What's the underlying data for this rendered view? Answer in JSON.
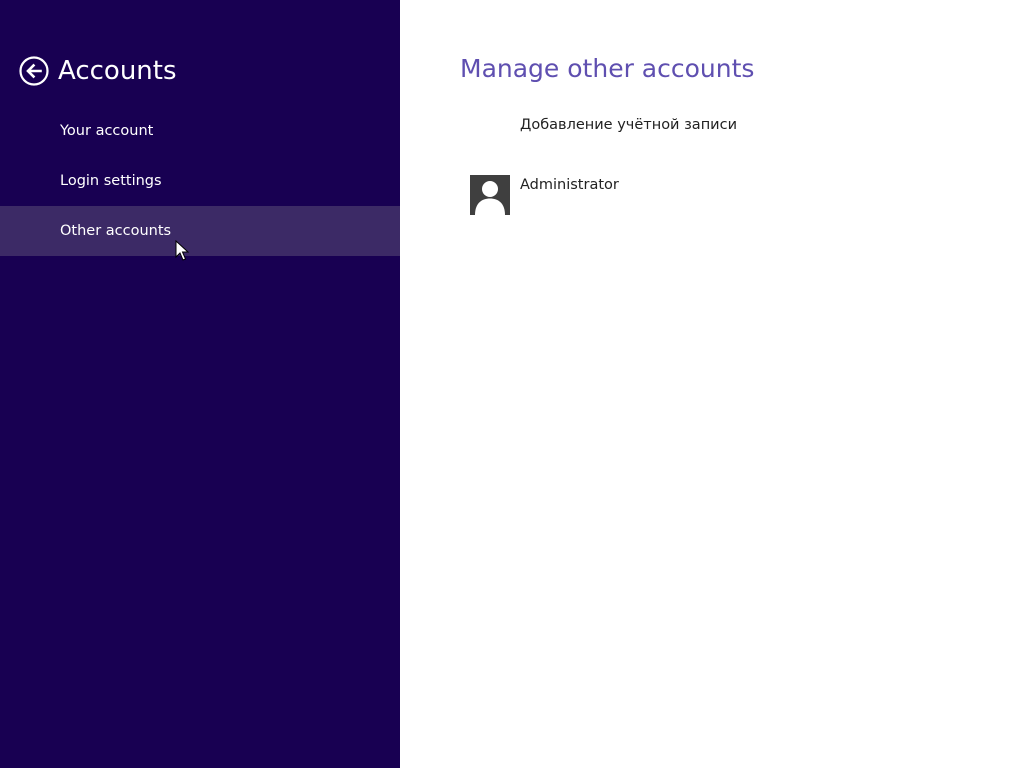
{
  "sidebar": {
    "back_icon": "back-arrow-circle-icon",
    "title": "Accounts",
    "items": [
      {
        "label": "Your account",
        "selected": false
      },
      {
        "label": "Login settings",
        "selected": false
      },
      {
        "label": "Other accounts",
        "selected": true
      }
    ]
  },
  "main": {
    "title": "Manage other accounts",
    "add_account_label": "Добавление учётной записи",
    "accounts": [
      {
        "name": "Administrator",
        "avatar_icon": "user-avatar-icon"
      }
    ]
  },
  "colors": {
    "sidebar_bg": "#180052",
    "selected_item_bg": "#3c2a66",
    "title_accent": "#5f4fb0",
    "content_bg": "#ffffff"
  }
}
